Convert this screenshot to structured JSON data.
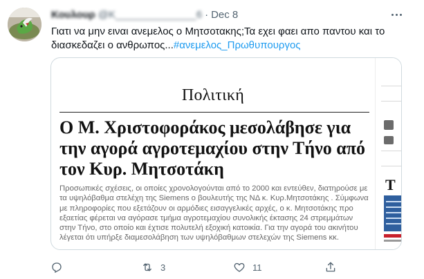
{
  "tweet": {
    "author_name": "Κουλουρ",
    "author_handle": "@Κ______________6",
    "separator": "·",
    "date": "Dec 8",
    "text_before": "Γιατι να μην ειναι ανεμελος ο Μητσοτακης;Τα εχει φαει απο παντου και το διασκεδαζει ο ανθρωπος...",
    "hashtag": "#ανεμελος_Πρωθυπουργος"
  },
  "article": {
    "section": "Πολιτική",
    "headline": "Ο Μ. Χριστοφοράκος μεσολάβησε για την αγορά αγροτεμαχίου στην Τήνο από τον Κυρ. Μητσοτάκη",
    "body": "Προσωπικές σχέσεις, οι οποίες χρονολογούνται από το 2000 και εντεύθεν, διατηρούσε με τα υψηλόβαθμα στελέχη της Siemens ο βουλευτής της ΝΔ κ. Κυρ.Μητσοτάκης . Σύμφωνα με πληροφορίες που εξετάζουν οι αρμόδιες εισαγγελικές αρχές, ο κ. Μητσοτάκης προ εξαετίας φέρεται να αγόρασε τμήμα αγροτεμαχίου συνολικής έκτασης 24 στρεμμάτων στην Τήνο, στο οποίο και έχτισε πολυτελή εξοχική κατοικία. Για την αγορά του ακινήτου λέγεται ότι υπήρξε διαμεσολάβηση των υψηλόβαθμων στελεχών της Siemens κκ.",
    "sidebar_letter": "T"
  },
  "actions": {
    "retweet_count": "3",
    "like_count": "11"
  },
  "icons": {
    "more": "more-dots-icon",
    "reply": "reply-icon",
    "retweet": "retweet-icon",
    "like": "heart-icon",
    "share": "share-icon"
  },
  "colors": {
    "link": "#1d9bf0",
    "secondary_text": "#536471",
    "primary_text": "#0f1419",
    "border": "#cfd9de"
  }
}
